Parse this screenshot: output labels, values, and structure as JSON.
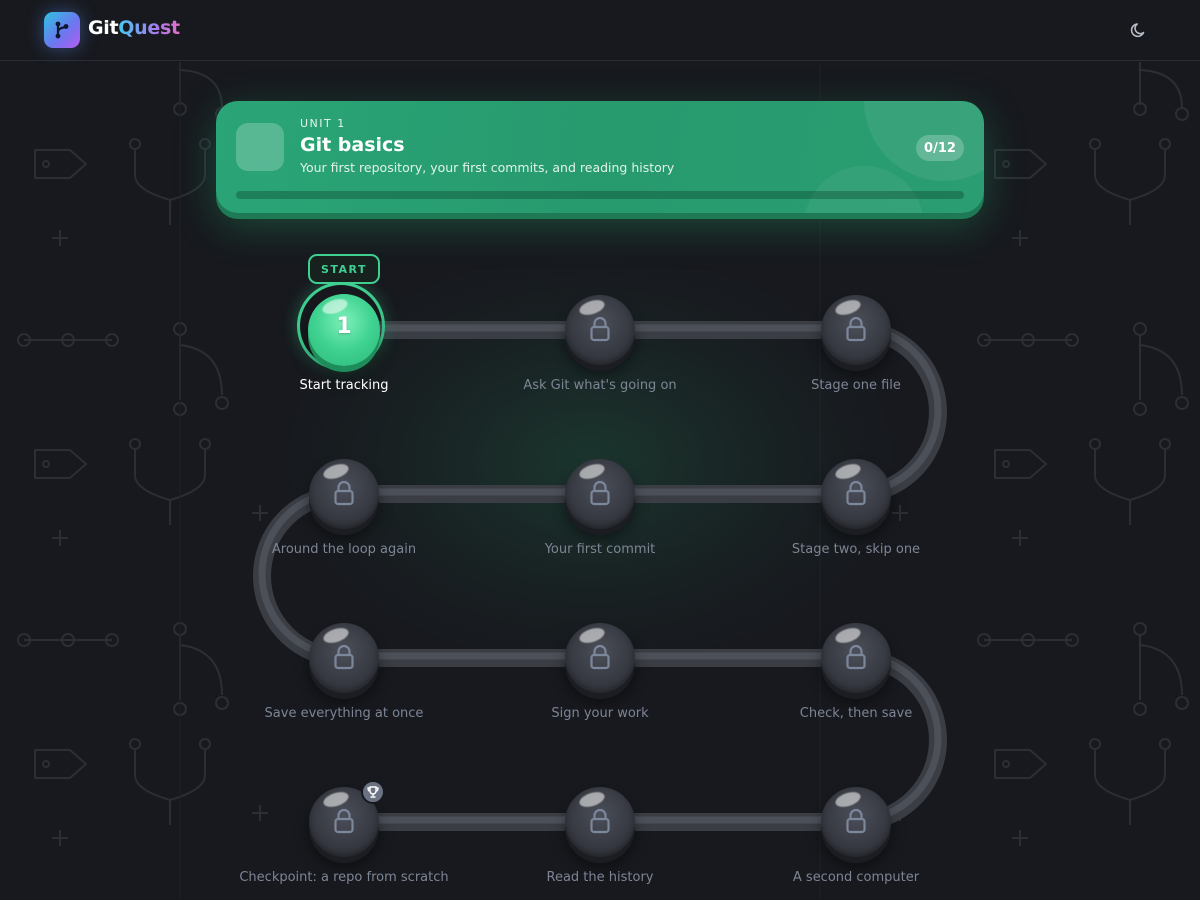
{
  "app": {
    "name_part1": "Git",
    "name_part2": "Quest"
  },
  "header": {
    "theme_toggle_icon": "moon-icon"
  },
  "unit": {
    "kicker": "UNIT 1",
    "title": "Git basics",
    "subtitle": "Your first repository, your first commits, and reading history",
    "progress_text": "0/12",
    "progress_fraction": 0
  },
  "path": {
    "start_badge": "START",
    "lessons": [
      {
        "number": "1",
        "label": "Start tracking",
        "state": "active"
      },
      {
        "label": "Ask Git what's going on",
        "state": "locked"
      },
      {
        "label": "Stage one file",
        "state": "locked"
      },
      {
        "label": "Stage two, skip one",
        "state": "locked"
      },
      {
        "label": "Your first commit",
        "state": "locked"
      },
      {
        "label": "Around the loop again",
        "state": "locked"
      },
      {
        "label": "Save everything at once",
        "state": "locked"
      },
      {
        "label": "Sign your work",
        "state": "locked"
      },
      {
        "label": "Check, then save",
        "state": "locked"
      },
      {
        "label": "A second computer",
        "state": "locked"
      },
      {
        "label": "Read the history",
        "state": "locked"
      },
      {
        "label": "Checkpoint: a repo from scratch",
        "state": "locked",
        "checkpoint": true
      }
    ]
  },
  "colors": {
    "background": "#17191e",
    "accent": "#3fcf90",
    "banner": "#2aa577",
    "locked_label": "#7d8595"
  }
}
